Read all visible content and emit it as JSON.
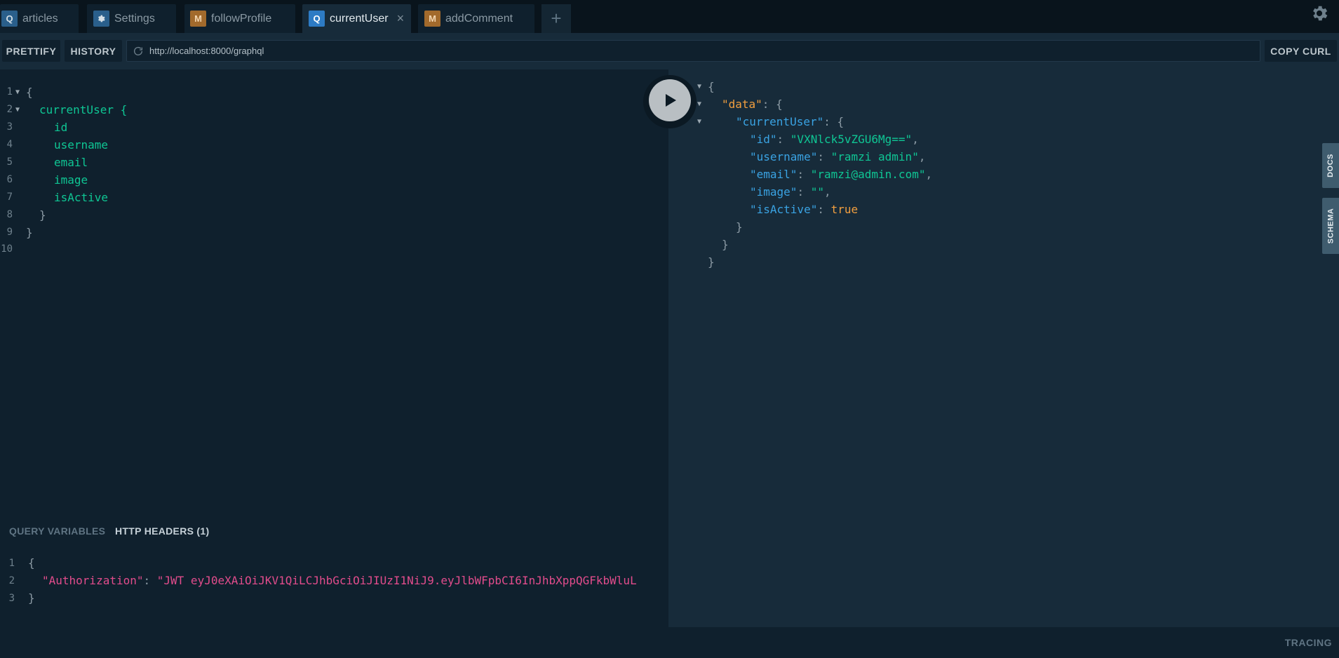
{
  "tabs": [
    {
      "badge": "Q",
      "label": "articles"
    },
    {
      "badge": "gear",
      "label": "Settings"
    },
    {
      "badge": "M",
      "label": "followProfile"
    },
    {
      "badge": "Q",
      "label": "currentUser",
      "active": true
    },
    {
      "badge": "M",
      "label": "addComment"
    }
  ],
  "tab_close_glyph": "×",
  "tab_add_glyph": "+",
  "toolbar": {
    "prettify_label": "PRETTIFY",
    "history_label": "HISTORY",
    "url_value": "http://localhost:8000/graphql",
    "copy_curl_label": "COPY CURL"
  },
  "query_lines": [
    {
      "n": "1",
      "text": "{"
    },
    {
      "n": "2",
      "text": "currentUser {"
    },
    {
      "n": "3",
      "text": "id"
    },
    {
      "n": "4",
      "text": "username"
    },
    {
      "n": "5",
      "text": "email"
    },
    {
      "n": "6",
      "text": "image"
    },
    {
      "n": "7",
      "text": "isActive"
    },
    {
      "n": "8",
      "text": "}"
    },
    {
      "n": "9",
      "text": "}"
    },
    {
      "n": "10",
      "text": ""
    }
  ],
  "result": {
    "open_brace": "{",
    "data_key": "\"data\"",
    "current_user_key": "\"currentUser\"",
    "fields": [
      {
        "key": "\"id\"",
        "value": "\"VXNlck5vZGU6Mg==\"",
        "comma": ","
      },
      {
        "key": "\"username\"",
        "value": "\"ramzi admin\"",
        "comma": ","
      },
      {
        "key": "\"email\"",
        "value": "\"ramzi@admin.com\"",
        "comma": ","
      },
      {
        "key": "\"image\"",
        "value": "\"\"",
        "comma": ","
      },
      {
        "key": "\"isActive\"",
        "value": "true",
        "comma": ""
      }
    ],
    "close_brace": "}"
  },
  "side_tabs": {
    "docs": "DOCS",
    "schema": "SCHEMA"
  },
  "vars_panel": {
    "query_variables_label": "QUERY VARIABLES",
    "http_headers_label": "HTTP HEADERS (1)",
    "lines": [
      {
        "n": "1",
        "text": "{"
      },
      {
        "n": "2",
        "key": "\"Authorization\"",
        "value": "\"JWT eyJ0eXAiOiJKV1QiLCJhbGciOiJIUzI1NiJ9.eyJlbWFpbCI6InJhbXppQGFkbWluL"
      },
      {
        "n": "3",
        "text": "}"
      }
    ]
  },
  "footer": {
    "tracing_label": "TRACING"
  },
  "colors": {
    "background": "#0f202d",
    "result_background": "#172b3a",
    "field": "#0fc694",
    "key": "#3aa3e3",
    "data_key": "#f29f3f",
    "header_key": "#e24c8c",
    "query_badge": "#2a5f8b",
    "mutation_badge": "#a26a2c"
  }
}
